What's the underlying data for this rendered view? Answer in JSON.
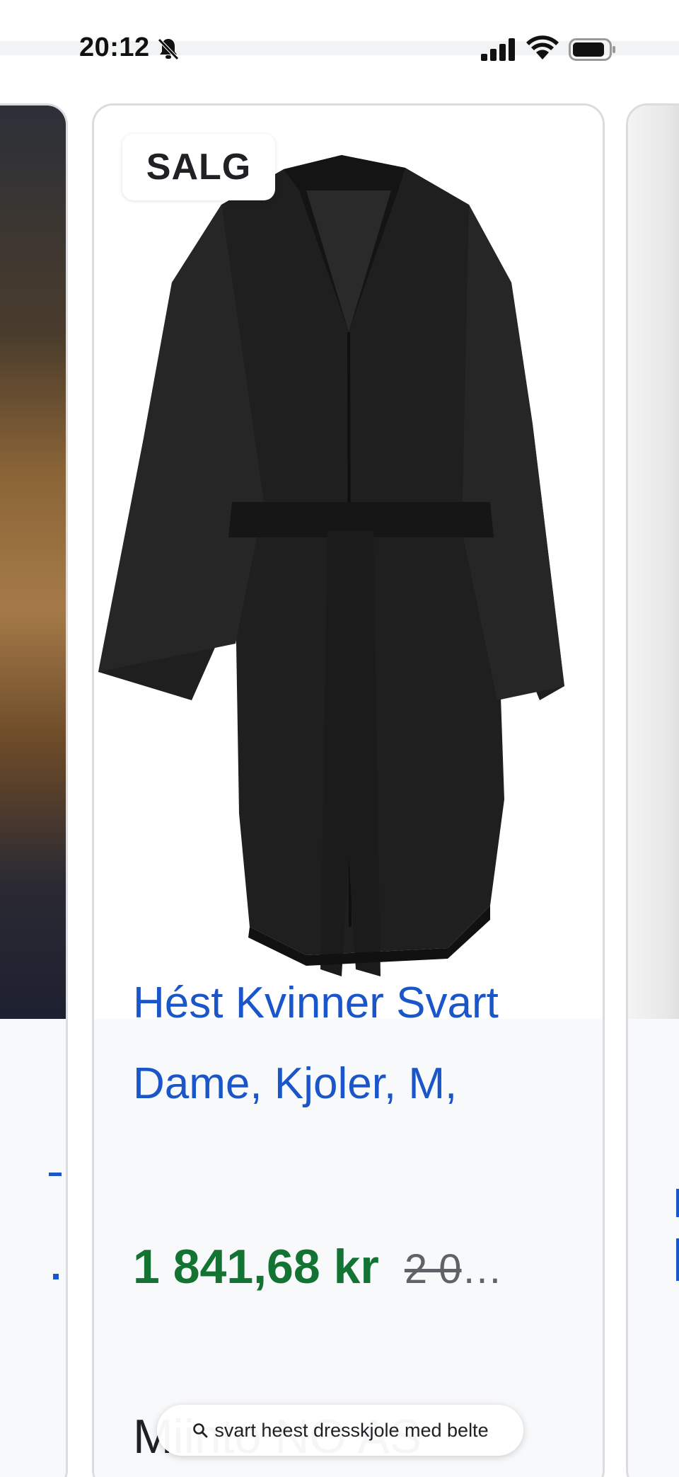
{
  "status_bar": {
    "time": "20:12",
    "icons": [
      "bell-slash-icon",
      "signal-icon",
      "wifi-icon",
      "battery-icon"
    ]
  },
  "product": {
    "badge": "SALG",
    "title": "Hést Kvinner Svart Dame, Kjoler, M,",
    "price": "1 841,68 kr",
    "old_price": "2 0",
    "ellipsis": "…",
    "seller": "Miinto NO AS"
  },
  "search_pill": {
    "query": "svart heest dresskjole med belte",
    "icon": "search-icon"
  },
  "colors": {
    "link_blue": "#1a56c9",
    "price_green": "#137333",
    "card_border": "#dadce0",
    "info_bg": "#f8f9fa"
  }
}
